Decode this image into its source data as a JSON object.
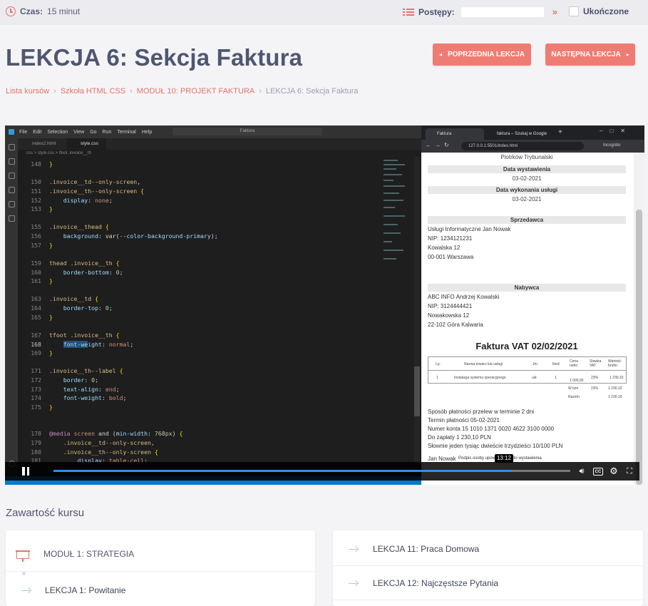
{
  "topbar": {
    "time_label": "Czas:",
    "time_value": "15 minut",
    "progress_label": "Postępy:",
    "done_label": "Ukończone"
  },
  "page_title": "LEKCJA 6: Sekcja Faktura",
  "buttons": {
    "prev": "POPRZEDNIA LEKCJA",
    "next": "NASTĘPNA LEKCJA"
  },
  "breadcrumb": [
    "Lista kursów",
    "Szkoła HTML CSS",
    "MODUŁ 10: PROJEKT FAKTURA",
    "LEKCJA 6: Sekcja Faktura"
  ],
  "video": {
    "editor": {
      "menu": [
        "File",
        "Edit",
        "Selection",
        "View",
        "Go",
        "Run",
        "Terminal",
        "Help"
      ],
      "search": "Faktura",
      "tabs": [
        "index2.html",
        "style.css"
      ],
      "breadcrumb": "css > style.css > tfoot .invoice__th"
    },
    "browser": {
      "tabs": [
        "Faktura",
        "faktura – Szukaj w Google"
      ],
      "url": "127.0.0.1:5501/index.html",
      "profile": "Incognito",
      "place": "Piotrków Trybunalski",
      "issue_date_label": "Data wystawienia",
      "issue_date": "03-02-2021",
      "service_date_label": "Data wykonania usługi",
      "service_date": "03-02-2021",
      "seller_label": "Sprzedawca",
      "seller_lines": [
        "Usługi Informatyczne Jan Nowak",
        "NIP: 1234121231",
        "Kowalska 12",
        "00-001 Warszawa"
      ],
      "buyer_label": "Nabywca",
      "buyer_lines": [
        "ABC INFO Andrzej Kowalski",
        "NIP: 3124444421",
        "Nowakowska 12",
        "22-102 Góra Kalwaria"
      ],
      "invoice_title": "Faktura VAT 02/02/2021",
      "table_headers": [
        "Lp.",
        "Nazwa towaru lub usługi",
        "Jm.",
        "Ilość",
        "Cena netto",
        "Stawka VAT",
        "Wartość brutto"
      ],
      "table_row": [
        "1",
        "Instalacja systemu operacyjnego",
        "usł.",
        "1",
        "1 000,00",
        "23%",
        "1 230,10"
      ],
      "sum_rows": [
        [
          "W tym",
          "23%",
          "1 230,10"
        ],
        [
          "Razem",
          "",
          "1 230,10"
        ]
      ],
      "payment_lines": [
        "Sposób płatności przelew w terminie 2 dni",
        "Termin płatności 05-02-2021",
        "Numer konta 15 1010 1371 0020 4622 3100 0000",
        "Do zapłaty 1 230,10 PLN",
        "Słownie jeden tysiąc dwieście trzydzieści 10/100 PLN"
      ],
      "signature": "Jan Nowak",
      "signature_note": "Podpis osoby upoważnionej do wystawienia"
    },
    "time_tooltip": "13:12",
    "progress_fraction": 0.885
  },
  "course": {
    "title": "Zawartość kursu",
    "left": [
      {
        "label": "MODUŁ 1: STRATEGIA",
        "kind": "module"
      },
      {
        "label": "LEKCJA 1: Powitanie",
        "kind": "lesson"
      }
    ],
    "right": [
      {
        "label": "LEKCJA 11: Praca Domowa",
        "kind": "lesson"
      },
      {
        "label": "LEKCJA 12: Najczęstsze Pytania",
        "kind": "lesson"
      }
    ]
  },
  "colors": {
    "accent": "#ef7c72",
    "title": "#4f5670",
    "seek": "#2a8ffe"
  }
}
